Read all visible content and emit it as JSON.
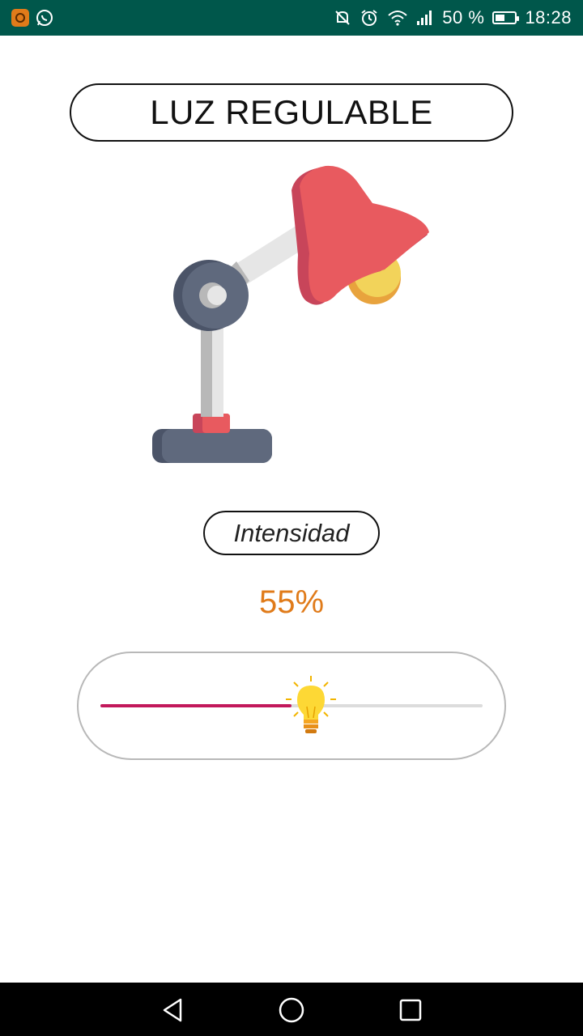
{
  "status_bar": {
    "battery_percent": "50 %",
    "time": "18:28",
    "battery_level": 0.5,
    "icons": [
      "app-notification-icon",
      "whatsapp-icon",
      "mute-icon",
      "alarm-icon",
      "wifi-icon",
      "signal-icon",
      "battery-icon"
    ]
  },
  "header": {
    "title": "LUZ REGULABLE"
  },
  "lamp": {
    "icon": "desk-lamp-icon"
  },
  "intensity": {
    "label": "Intensidad",
    "value_text": "55%",
    "value": 0.55,
    "thumb_icon": "light-bulb-icon"
  },
  "colors": {
    "status_bar": "#00574b",
    "accent_orange": "#e07b1a",
    "slider_fill": "#c2185b",
    "slider_track": "#dcdcdc"
  },
  "nav_bar": {
    "icons": [
      "back-icon",
      "home-icon",
      "recents-icon"
    ]
  }
}
